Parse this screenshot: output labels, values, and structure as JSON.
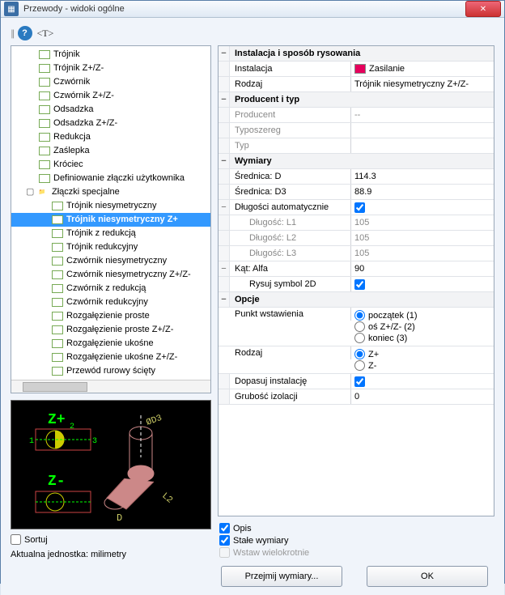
{
  "window": {
    "title": "Przewody - widoki ogólne"
  },
  "toolbar": {
    "help": "?",
    "tag": "<T>"
  },
  "tree": {
    "top": [
      "Trójnik",
      "Trójnik Z+/Z-",
      "Czwórnik",
      "Czwórnik Z+/Z-",
      "Odsadzka",
      "Odsadzka Z+/Z-",
      "Redukcja",
      "Zaślepka",
      "Króciec",
      "Definiowanie złączki użytkownika"
    ],
    "group_label": "Złączki specjalne",
    "special": [
      "Trójnik niesymetryczny",
      "Trójnik niesymetryczny Z+",
      "Trójnik z redukcją",
      "Trójnik redukcyjny",
      "Czwórnik niesymetryczny",
      "Czwórnik niesymetryczny Z+/Z-",
      "Czwórnik z redukcją",
      "Czwórnik redukcyjny",
      "Rozgałęzienie proste",
      "Rozgałęzienie proste Z+/Z-",
      "Rozgałęzienie ukośne",
      "Rozgałęzienie ukośne Z+/Z-",
      "Przewód rurowy ścięty"
    ],
    "selected_index": 1
  },
  "props": {
    "section_install": "Instalacja i sposób rysowania",
    "instalacja_label": "Instalacja",
    "instalacja_value": "Zasilanie",
    "rodzaj_label": "Rodzaj",
    "rodzaj_value": "Trójnik niesymetryczny Z+/Z-",
    "section_prod": "Producent i typ",
    "producent_label": "Producent",
    "producent_value": "--",
    "typoszereg_label": "Typoszereg",
    "typoszereg_value": "",
    "typ_label": "Typ",
    "typ_value": "",
    "section_wym": "Wymiary",
    "sred_d_label": "Średnica: D",
    "sred_d_value": "114.3",
    "sred_d3_label": "Średnica: D3",
    "sred_d3_value": "88.9",
    "auto_label": "Długości automatycznie",
    "l1_label": "Długość: L1",
    "l1_value": "105",
    "l2_label": "Długość: L2",
    "l2_value": "105",
    "l3_label": "Długość: L3",
    "l3_value": "105",
    "kat_label": "Kąt: Alfa",
    "kat_value": "90",
    "rysuj2d_label": "Rysuj symbol 2D",
    "section_opcje": "Opcje",
    "punkt_label": "Punkt wstawienia",
    "punkt_opts": [
      "początek (1)",
      "oś Z+/Z- (2)",
      "koniec (3)"
    ],
    "rodzaj2_label": "Rodzaj",
    "rodzaj2_opts": [
      "Z+",
      "Z-"
    ],
    "dopasuj_label": "Dopasuj instalację",
    "grub_label": "Grubość izolacji",
    "grub_value": "0"
  },
  "checks": {
    "opis": "Opis",
    "stale": "Stałe wymiary",
    "wstaw": "Wstaw wielokrotnie"
  },
  "sort": "Sortuj",
  "unit": "Aktualna jednostka: milimetry",
  "buttons": {
    "przejmij": "Przejmij wymiary...",
    "ok": "OK"
  },
  "preview": {
    "zplus": "Z+",
    "zminus": "Z-",
    "d": "D",
    "d3": "ØD3",
    "l2": "L2",
    "n1": "1",
    "n2": "2",
    "n3": "3"
  }
}
